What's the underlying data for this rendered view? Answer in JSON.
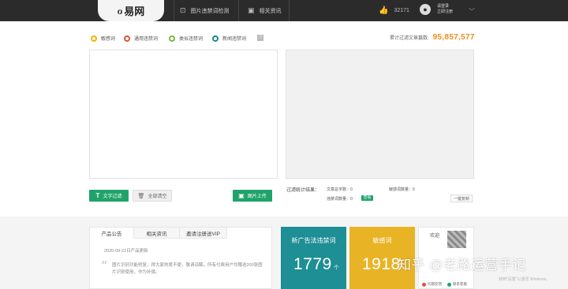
{
  "header": {
    "logo_text": "易网",
    "logo_mark": "ℴ",
    "nav": [
      {
        "label": "图片违禁词检测"
      },
      {
        "label": "相关资讯"
      }
    ],
    "likes_count": "32171",
    "user_line1": "请登录",
    "user_line2": "立即注册"
  },
  "legend": [
    {
      "label": "敏感词",
      "color": "#f0b400"
    },
    {
      "label": "通用违禁词",
      "color": "#e0543c"
    },
    {
      "label": "类似违禁词",
      "color": "#7ab840"
    },
    {
      "label": "新闻违禁词",
      "color": "#1a8c8c"
    }
  ],
  "help_mark": "?",
  "total": {
    "label": "累计过滤文章篇数:",
    "value": "95,857,577"
  },
  "buttons": {
    "text_filter": "文字过滤",
    "text_filter_icon": "T",
    "clear_all": "全部清空",
    "upload_image": "图片上传"
  },
  "stats": {
    "title": "过滤统计结果：",
    "total_chars": "文章总字数：0",
    "sensitive_count": "敏感词数量：0",
    "banned_count": "违禁词数量：0",
    "view_badge": "查看",
    "copy_button": "一键复制"
  },
  "notice": {
    "tabs": [
      "产品公告",
      "相关资讯",
      "邀请注册送VIP"
    ],
    "date": "2020-09-22日产品更新",
    "text": "图片识别功能修复，得大家热爱不便，敬请谅解。所有付费用户均赠送200张图片识别使用，作为补偿。"
  },
  "cards": [
    {
      "title": "新广告法违禁词",
      "value": "1779",
      "unit": "个",
      "color": "#1e8f95"
    },
    {
      "title": "敏感词",
      "value": "1918",
      "unit": "",
      "color": "#e8b425"
    }
  ],
  "welcome": {
    "label": "欢迎",
    "feedback": "问题反馈",
    "service": "联系客服"
  },
  "watermark": "知乎 @老路运营手记",
  "win_watermark": "转到\"设置\"以激活 Windows。"
}
